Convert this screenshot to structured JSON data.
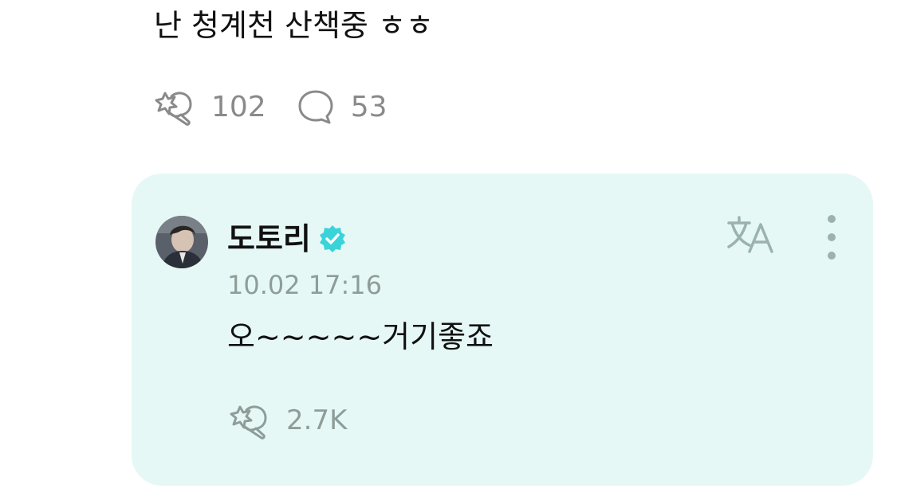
{
  "post": {
    "text": "난 청계천 산책중 ㅎㅎ",
    "like_icon": "bulb-star-icon",
    "like_count": "102",
    "comment_icon": "speech-bubble-icon",
    "comment_count": "53"
  },
  "reply": {
    "author": "도토리",
    "verified_icon": "verified-badge-icon",
    "timestamp": "10.02 17:16",
    "text": "오~~~~~거기좋죠",
    "like_icon": "bulb-star-icon",
    "like_count": "2.7K",
    "translate_icon": "translate-icon",
    "more_icon": "more-vertical-icon",
    "card_color": "#e6f8f6",
    "badge_color": "#39d3d9"
  }
}
